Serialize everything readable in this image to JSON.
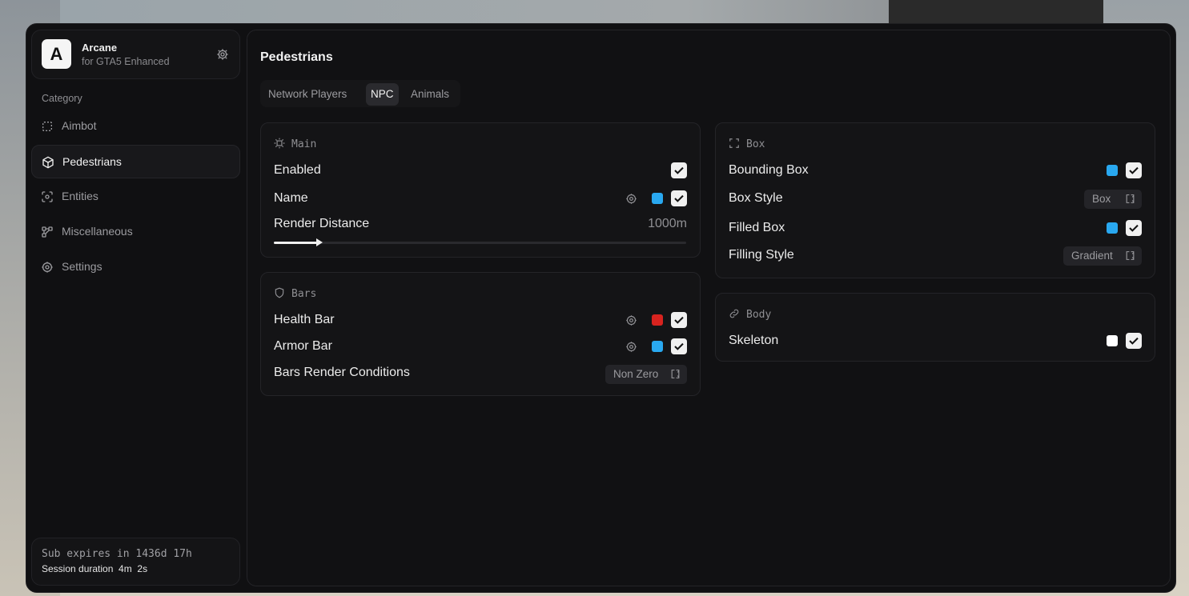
{
  "app": {
    "name": "Arcane",
    "subtitle": "for GTA5 Enhanced",
    "logo_letter": "A"
  },
  "sidebar": {
    "category_label": "Category",
    "items": [
      {
        "label": "Aimbot",
        "icon": "crosshair-icon",
        "active": false
      },
      {
        "label": "Pedestrians",
        "icon": "cube-icon",
        "active": true
      },
      {
        "label": "Entities",
        "icon": "scan-icon",
        "active": false
      },
      {
        "label": "Miscellaneous",
        "icon": "nodes-icon",
        "active": false
      },
      {
        "label": "Settings",
        "icon": "gear-icon",
        "active": false
      }
    ],
    "footer": {
      "subscription": "Sub expires in 1436d 17h",
      "session": "Session duration  4m  2s"
    }
  },
  "page": {
    "title": "Pedestrians",
    "tabs": [
      {
        "label": "Network Players",
        "active": false
      },
      {
        "label": "NPC",
        "active": true
      },
      {
        "label": "Animals",
        "active": false
      }
    ]
  },
  "cards": {
    "main": {
      "title": "Main",
      "enabled_label": "Enabled",
      "name_label": "Name",
      "name_color": "#29a8f0",
      "render_distance_label": "Render Distance",
      "render_distance_value": "1000m",
      "render_distance_fraction": 0.11
    },
    "bars": {
      "title": "Bars",
      "health_label": "Health Bar",
      "health_color": "#d8231f",
      "armor_label": "Armor Bar",
      "armor_color": "#29a8f0",
      "conditions_label": "Bars Render Conditions",
      "conditions_value": "Non Zero"
    },
    "box": {
      "title": "Box",
      "bounding_label": "Bounding Box",
      "bounding_color": "#29a8f0",
      "style_label": "Box Style",
      "style_value": "Box",
      "filled_label": "Filled Box",
      "filled_color": "#29a8f0",
      "filling_label": "Filling Style",
      "filling_value": "Gradient"
    },
    "body": {
      "title": "Body",
      "skeleton_label": "Skeleton",
      "skeleton_color": "#ffffff"
    }
  }
}
